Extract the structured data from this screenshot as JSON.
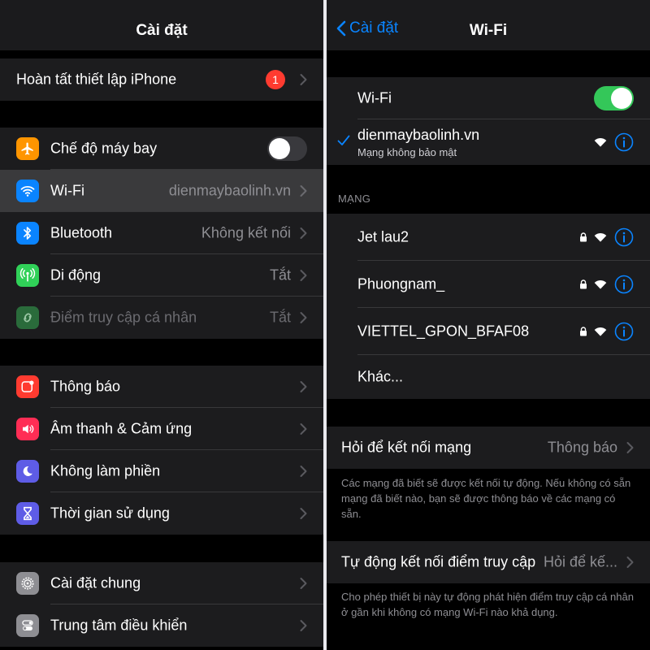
{
  "left": {
    "title": "Cài đặt",
    "finish_setup": {
      "label": "Hoàn tất thiết lập iPhone",
      "badge": "1"
    },
    "group1": [
      {
        "label": "Chế độ máy bay",
        "value": "",
        "icon": "airplane-icon",
        "color": "#ff9500"
      },
      {
        "label": "Wi-Fi",
        "value": "dienmaybaolinh.vn",
        "icon": "wifi-icon",
        "color": "#0a84ff"
      },
      {
        "label": "Bluetooth",
        "value": "Không kết nối",
        "icon": "bluetooth-icon",
        "color": "#0a84ff"
      },
      {
        "label": "Di động",
        "value": "Tắt",
        "icon": "antenna-icon",
        "color": "#30d158"
      },
      {
        "label": "Điểm truy cập cá nhân",
        "value": "Tắt",
        "icon": "hotspot-icon",
        "color": "#30d158"
      }
    ],
    "group2": [
      {
        "label": "Thông báo",
        "icon": "notification-icon",
        "color": "#ff3b30"
      },
      {
        "label": "Âm thanh & Cảm ứng",
        "icon": "speaker-icon",
        "color": "#ff2d55"
      },
      {
        "label": "Không làm phiền",
        "icon": "moon-icon",
        "color": "#5e5ce6"
      },
      {
        "label": "Thời gian sử dụng",
        "icon": "hourglass-icon",
        "color": "#5e5ce6"
      }
    ],
    "group3": [
      {
        "label": "Cài đặt chung",
        "icon": "gear-icon",
        "color": "#8e8e93"
      },
      {
        "label": "Trung tâm điều khiển",
        "icon": "switches-icon",
        "color": "#8e8e93"
      }
    ]
  },
  "right": {
    "back_label": "Cài đặt",
    "title": "Wi-Fi",
    "wifi_toggle_label": "Wi-Fi",
    "connected": {
      "name": "dienmaybaolinh.vn",
      "subtitle": "Mạng không bảo mật"
    },
    "networks_header": "MẠNG",
    "networks": [
      {
        "name": "Jet lau2"
      },
      {
        "name": "Phuongnam_"
      },
      {
        "name": "VIETTEL_GPON_BFAF08"
      }
    ],
    "other_label": "Khác...",
    "ask_join": {
      "label": "Hỏi để kết nối mạng",
      "value": "Thông báo"
    },
    "ask_join_footer": "Các mạng đã biết sẽ được kết nối tự động. Nếu không có sẵn mạng đã biết nào, bạn sẽ được thông báo về các mạng có sẵn.",
    "auto_join": {
      "label": "Tự động kết nối điểm truy cập",
      "value": "Hỏi để kế..."
    },
    "auto_join_footer": "Cho phép thiết bị này tự động phát hiện điểm truy cập cá nhân ở gần khi không có mạng Wi-Fi nào khả dụng."
  },
  "colors": {
    "accent": "#0a84ff",
    "toggle_on": "#34c759",
    "badge": "#ff3b30"
  }
}
